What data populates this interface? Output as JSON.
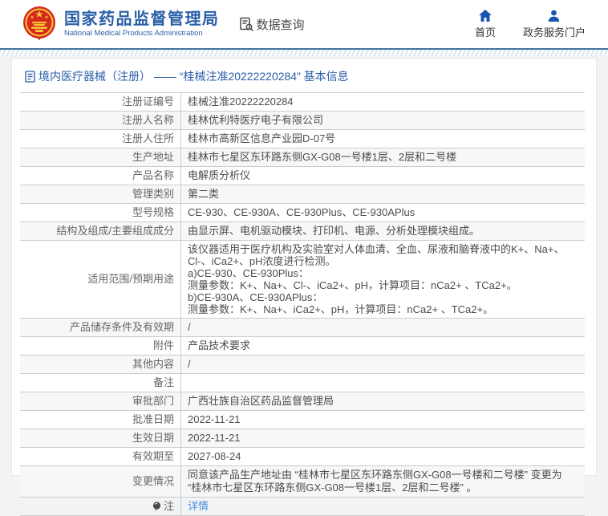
{
  "header": {
    "org_name_zh": "国家药品监督管理局",
    "org_name_en": "National Medical Products Administration",
    "data_query_label": "数据查询",
    "nav": [
      {
        "label": "首页",
        "icon": "home-icon"
      },
      {
        "label": "政务服务门户",
        "icon": "user-icon"
      }
    ]
  },
  "colors": {
    "brand_blue": "#2a5fa8",
    "nav_icon_blue": "#1a56b0",
    "link_blue": "#4a90d9",
    "emblem_red": "#d7281e",
    "emblem_gold": "#f5c934"
  },
  "breadcrumb": {
    "text": "境内医疗器械（注册） —— “桂械注准20222220284” 基本信息",
    "icon": "document-icon"
  },
  "table": {
    "rows": [
      {
        "label": "注册证编号",
        "value": "桂械注准20222220284"
      },
      {
        "label": "注册人名称",
        "value": "桂林优利特医疗电子有限公司"
      },
      {
        "label": "注册人住所",
        "value": "桂林市高新区信息产业园D-07号"
      },
      {
        "label": "生产地址",
        "value": "桂林市七星区东环路东侧GX-G08一号楼1层、2层和二号楼"
      },
      {
        "label": "产品名称",
        "value": "电解质分析仪"
      },
      {
        "label": "管理类别",
        "value": "第二类"
      },
      {
        "label": "型号规格",
        "value": "CE-930、CE-930A、CE-930Plus、CE-930APlus"
      },
      {
        "label": "结构及组成/主要组成成分",
        "value": "由显示屏、电机驱动模块、打印机、电源、分析处理模块组成。"
      },
      {
        "label": "适用范围/预期用途",
        "lines": [
          "该仪器适用于医疗机构及实验室对人体血清、全血、尿液和脑脊液中的K+、Na+、Cl-、iCa2+、pH浓度进行检测。",
          "a)CE-930、CE-930Plus：",
          "测量参数：K+、Na+、Cl-、iCa2+、pH，计算项目：nCa2+ 、TCa2+。",
          "b)CE-930A、CE-930APlus：",
          "测量参数：K+、Na+、iCa2+、pH，计算项目：nCa2+ 、TCa2+。"
        ]
      },
      {
        "label": "产品储存条件及有效期",
        "value": "/"
      },
      {
        "label": "附件",
        "value": "产品技术要求"
      },
      {
        "label": "其他内容",
        "value": "/"
      },
      {
        "label": "备注",
        "value": ""
      },
      {
        "label": "审批部门",
        "value": "广西壮族自治区药品监督管理局"
      },
      {
        "label": "批准日期",
        "value": "2022-11-21"
      },
      {
        "label": "生效日期",
        "value": "2022-11-21"
      },
      {
        "label": "有效期至",
        "value": "2027-08-24"
      },
      {
        "label": "变更情况",
        "value": "同意该产品生产地址由 “桂林市七星区东环路东侧GX-G08一号楼和二号楼” 变更为 “桂林市七星区东环路东侧GX-G08一号楼1层、2层和二号楼” 。"
      },
      {
        "label": "注",
        "icon": "note-icon",
        "value": "详情",
        "link": true
      }
    ]
  }
}
